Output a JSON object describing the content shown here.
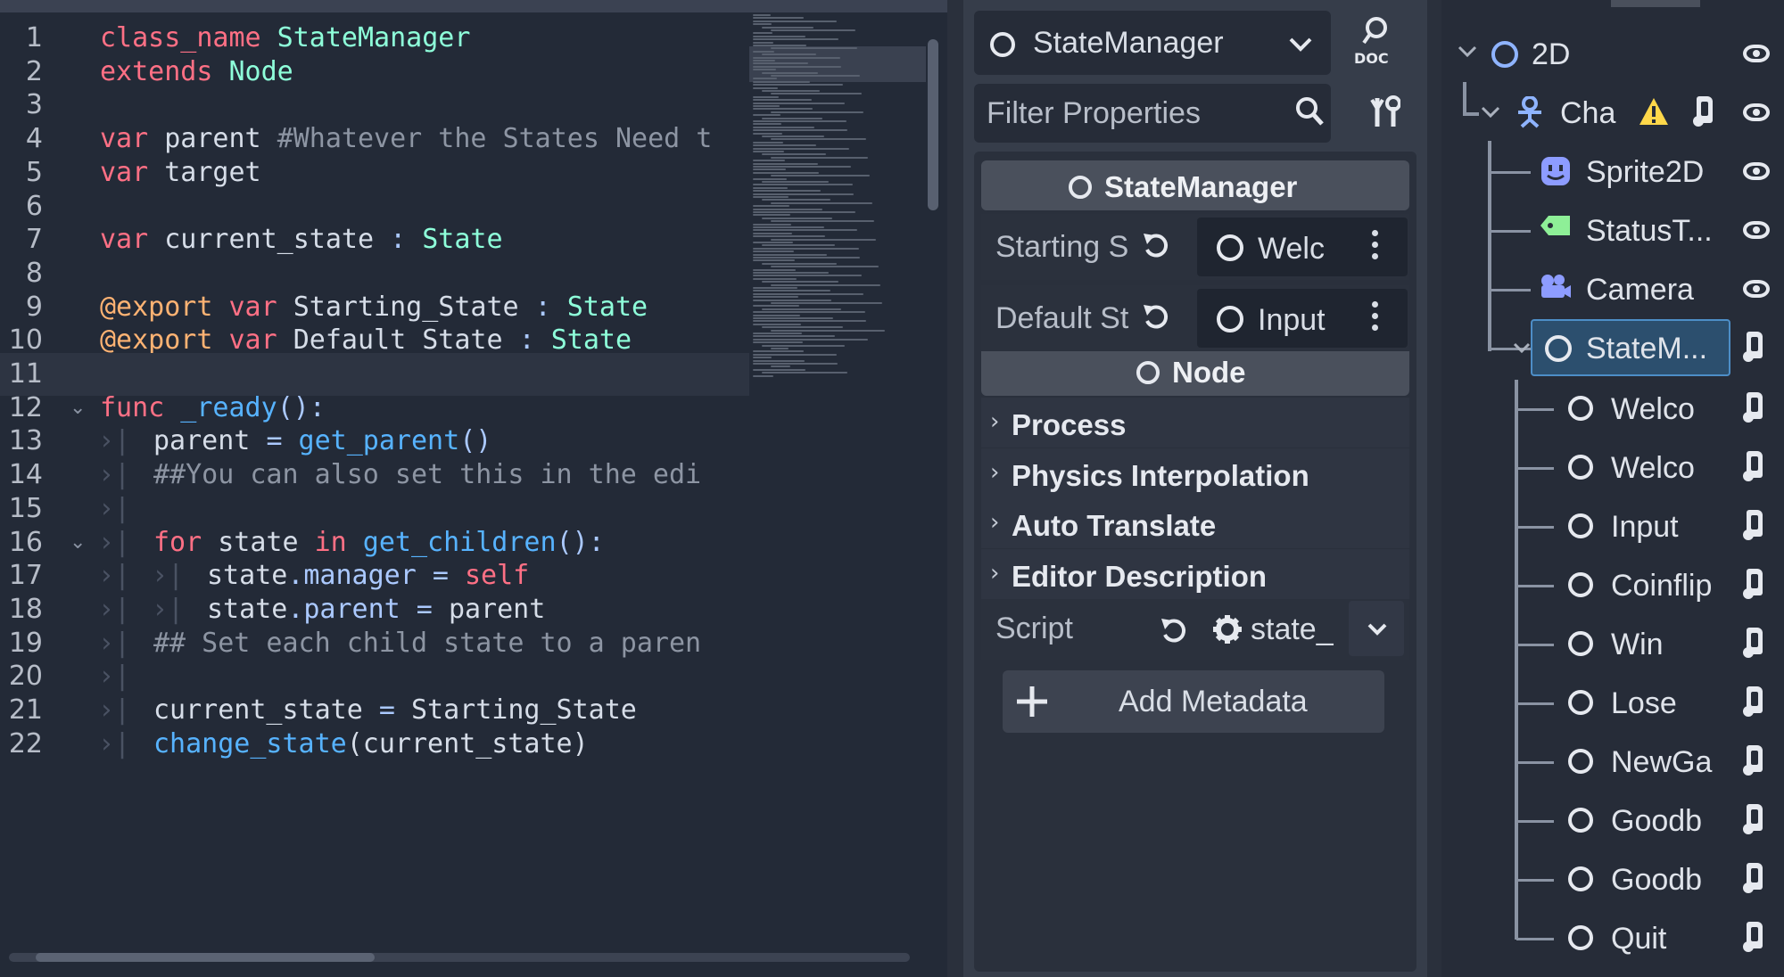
{
  "code_editor": {
    "lines": [
      {
        "num": "1",
        "tokens": [
          {
            "t": "class_name",
            "c": "kw"
          },
          {
            "t": " StateManager",
            "c": "ty"
          }
        ]
      },
      {
        "num": "2",
        "tokens": [
          {
            "t": "extends",
            "c": "kw"
          },
          {
            "t": " Node",
            "c": "ty"
          }
        ]
      },
      {
        "num": "3",
        "tokens": []
      },
      {
        "num": "4",
        "tokens": [
          {
            "t": "var",
            "c": "kw"
          },
          {
            "t": " parent ",
            "c": ""
          },
          {
            "t": "#Whatever the States Need t",
            "c": "cm"
          }
        ]
      },
      {
        "num": "5",
        "tokens": [
          {
            "t": "var",
            "c": "kw"
          },
          {
            "t": " target",
            "c": ""
          }
        ]
      },
      {
        "num": "6",
        "tokens": []
      },
      {
        "num": "7",
        "tokens": [
          {
            "t": "var",
            "c": "kw"
          },
          {
            "t": " current_state ",
            "c": ""
          },
          {
            "t": ":",
            "c": "pn"
          },
          {
            "t": " State",
            "c": "ty"
          }
        ]
      },
      {
        "num": "8",
        "tokens": []
      },
      {
        "num": "9",
        "tokens": [
          {
            "t": "@export",
            "c": "an"
          },
          {
            "t": " var",
            "c": "kw"
          },
          {
            "t": " Starting_State ",
            "c": ""
          },
          {
            "t": ":",
            "c": "pn"
          },
          {
            "t": " State",
            "c": "ty"
          }
        ]
      },
      {
        "num": "10",
        "tokens": [
          {
            "t": "@export",
            "c": "an"
          },
          {
            "t": " var",
            "c": "kw"
          },
          {
            "t": " Default_State ",
            "c": ""
          },
          {
            "t": ":",
            "c": "pn"
          },
          {
            "t": " State",
            "c": "ty"
          }
        ]
      },
      {
        "num": "11",
        "tokens": [],
        "current": true
      },
      {
        "num": "12",
        "fold": "⌄",
        "tokens": [
          {
            "t": "func",
            "c": "kw"
          },
          {
            "t": " _ready",
            "c": "fn"
          },
          {
            "t": "():",
            "c": "pn"
          }
        ]
      },
      {
        "num": "13",
        "tabs": 1,
        "tokens": [
          {
            "t": "parent ",
            "c": ""
          },
          {
            "t": "=",
            "c": "pn"
          },
          {
            "t": " get_parent",
            "c": "fn"
          },
          {
            "t": "()",
            "c": "pn"
          }
        ]
      },
      {
        "num": "14",
        "tabs": 1,
        "tokens": [
          {
            "t": "##You can also set this in the edi",
            "c": "cm"
          }
        ]
      },
      {
        "num": "15",
        "tabs": 1,
        "tokens": []
      },
      {
        "num": "16",
        "tabs": 1,
        "fold": "⌄",
        "tokens": [
          {
            "t": "for",
            "c": "kw"
          },
          {
            "t": " state ",
            "c": ""
          },
          {
            "t": "in",
            "c": "kw"
          },
          {
            "t": " get_children",
            "c": "fn"
          },
          {
            "t": "():",
            "c": "pn"
          }
        ]
      },
      {
        "num": "17",
        "tabs": 2,
        "tokens": [
          {
            "t": "state",
            "c": ""
          },
          {
            "t": ".manager",
            "c": "pn"
          },
          {
            "t": " = ",
            "c": "pn"
          },
          {
            "t": "self",
            "c": "kw"
          }
        ]
      },
      {
        "num": "18",
        "tabs": 2,
        "tokens": [
          {
            "t": "state",
            "c": ""
          },
          {
            "t": ".parent",
            "c": "pn"
          },
          {
            "t": " = ",
            "c": "pn"
          },
          {
            "t": "parent",
            "c": ""
          }
        ]
      },
      {
        "num": "19",
        "tabs": 1,
        "tokens": [
          {
            "t": "## Set each child state to a paren",
            "c": "cm"
          }
        ]
      },
      {
        "num": "20",
        "tabs": 1,
        "tokens": []
      },
      {
        "num": "21",
        "tabs": 1,
        "tokens": [
          {
            "t": "current_state ",
            "c": ""
          },
          {
            "t": "=",
            "c": "pn"
          },
          {
            "t": " Starting_State",
            "c": ""
          }
        ]
      },
      {
        "num": "22",
        "tabs": 1,
        "tokens": [
          {
            "t": "change_state",
            "c": "fn"
          },
          {
            "t": "(current_state)",
            "c": ""
          }
        ]
      }
    ]
  },
  "inspector": {
    "object_selector": {
      "label": "StateManager",
      "icon": "node-circle-icon"
    },
    "doc_button": "DOC",
    "filter": {
      "placeholder": "Filter Properties"
    },
    "script_section": {
      "title": "StateManager"
    },
    "properties": [
      {
        "name": "Starting S",
        "value": "Welc"
      },
      {
        "name": "Default St",
        "value": "Input"
      }
    ],
    "node_section": {
      "title": "Node"
    },
    "categories": [
      "Process",
      "Physics Interpolation",
      "Auto Translate",
      "Editor Description"
    ],
    "script_row": {
      "name": "Script",
      "value": "state_"
    },
    "add_metadata": {
      "label": "Add Metadata"
    },
    "colors": {
      "panel": "#363d4a",
      "box": "#262c38",
      "header": "#4a505c"
    }
  },
  "scene_tree": {
    "root": {
      "label": "2D"
    },
    "character": {
      "label": "Cha"
    },
    "children": [
      {
        "label": "Sprite2D",
        "icon": "sprite-icon"
      },
      {
        "label": "StatusT...",
        "icon": "label-tag-icon"
      },
      {
        "label": "Camera",
        "icon": "camera-icon"
      },
      {
        "label": "StateM...",
        "icon": "node-circle-icon",
        "selected": true
      }
    ],
    "states": [
      "Welco",
      "Welco",
      "Input",
      "Coinflip",
      "Win",
      "Lose",
      "NewGa",
      "Goodb",
      "Goodb",
      "Quit"
    ],
    "colors": {
      "selected_bg": "#2c4f6e",
      "selected_border": "#4d8ec7"
    }
  }
}
